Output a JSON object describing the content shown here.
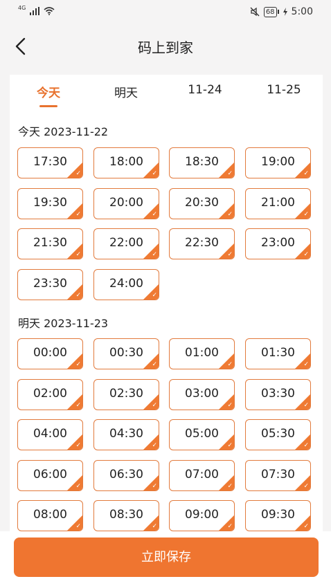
{
  "status_bar": {
    "network": "4G",
    "battery": "68",
    "time": "5:00"
  },
  "header": {
    "title": "码上到家"
  },
  "tabs": [
    "今天",
    "明天",
    "11-24",
    "11-25"
  ],
  "sections": [
    {
      "label": "今天 2023-11-22",
      "slots": [
        "17:30",
        "18:00",
        "18:30",
        "19:00",
        "19:30",
        "20:00",
        "20:30",
        "21:00",
        "21:30",
        "22:00",
        "22:30",
        "23:00",
        "23:30",
        "24:00"
      ]
    },
    {
      "label": "明天 2023-11-23",
      "slots": [
        "00:00",
        "00:30",
        "01:00",
        "01:30",
        "02:00",
        "02:30",
        "03:00",
        "03:30",
        "04:00",
        "04:30",
        "05:00",
        "05:30",
        "06:00",
        "06:30",
        "07:00",
        "07:30",
        "08:00",
        "08:30",
        "09:00",
        "09:30"
      ]
    }
  ],
  "save_button": "立即保存"
}
